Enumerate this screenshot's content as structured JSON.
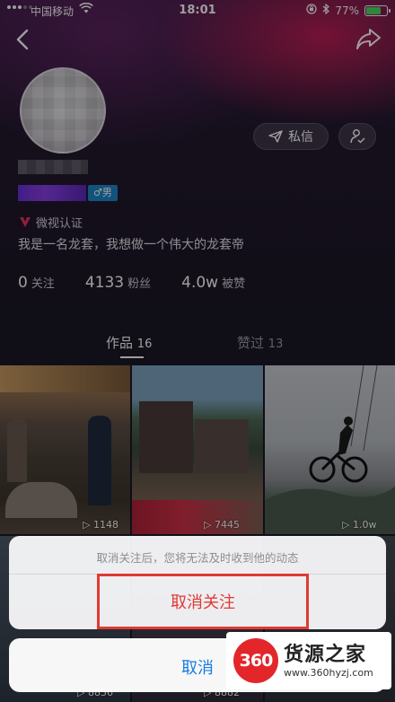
{
  "status_bar": {
    "carrier": "中国移动",
    "time": "18:01",
    "battery": "77%",
    "battery_level": 0.77
  },
  "profile": {
    "dm_label": "私信",
    "gender_tag": "♂男",
    "verify_label": "微视认证",
    "bio": "我是一名龙套，我想做一个伟大的龙套帝",
    "stats": [
      {
        "value": "0",
        "label": "关注"
      },
      {
        "value": "4133",
        "label": "粉丝"
      },
      {
        "value": "4.0w",
        "label": "被赞"
      }
    ]
  },
  "tabs": {
    "works": {
      "label": "作品",
      "count": "16"
    },
    "liked": {
      "label": "赞过",
      "count": "13"
    }
  },
  "videos": [
    {
      "views": "1148"
    },
    {
      "views": "7445"
    },
    {
      "views": "1.0w"
    },
    {
      "views": "8856"
    },
    {
      "views": "8882"
    }
  ],
  "action_sheet": {
    "message": "取消关注后，您将无法及时收到他的动态",
    "unfollow_label": "取消关注",
    "cancel_label": "取消"
  },
  "watermark": {
    "logo": "360",
    "name": "货源之家",
    "url": "www.360hyzj.com"
  },
  "colors": {
    "accent_red": "#e03a34",
    "cancel_blue": "#1a7ce0",
    "verify_pink": "#e8335f"
  }
}
